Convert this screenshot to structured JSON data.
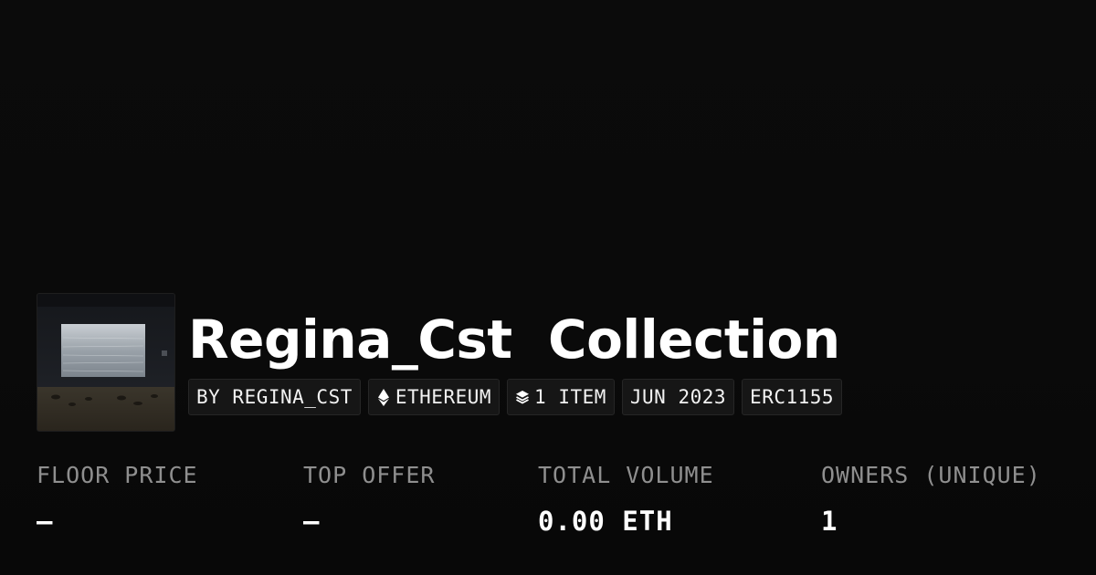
{
  "collection": {
    "name": "Regina_Cst  Collection",
    "thumbnail_icon": "collection-thumbnail"
  },
  "chips": {
    "creator": "BY REGINA_CST",
    "chain": "ETHEREUM",
    "chain_icon": "ethereum-icon",
    "items": "1 ITEM",
    "items_icon": "layers-icon",
    "date": "JUN 2023",
    "standard": "ERC1155"
  },
  "stats": {
    "floor_price": {
      "label": "FLOOR PRICE",
      "value": "–"
    },
    "top_offer": {
      "label": "TOP OFFER",
      "value": "–"
    },
    "total_volume": {
      "label": "TOTAL VOLUME",
      "value": "0.00 ETH"
    },
    "owners": {
      "label": "OWNERS (UNIQUE)",
      "value": "1"
    }
  },
  "colors": {
    "background": "#0b0b0b",
    "text": "#ffffff",
    "muted_label": "#8f8f8f",
    "chip_background": "#161616"
  }
}
